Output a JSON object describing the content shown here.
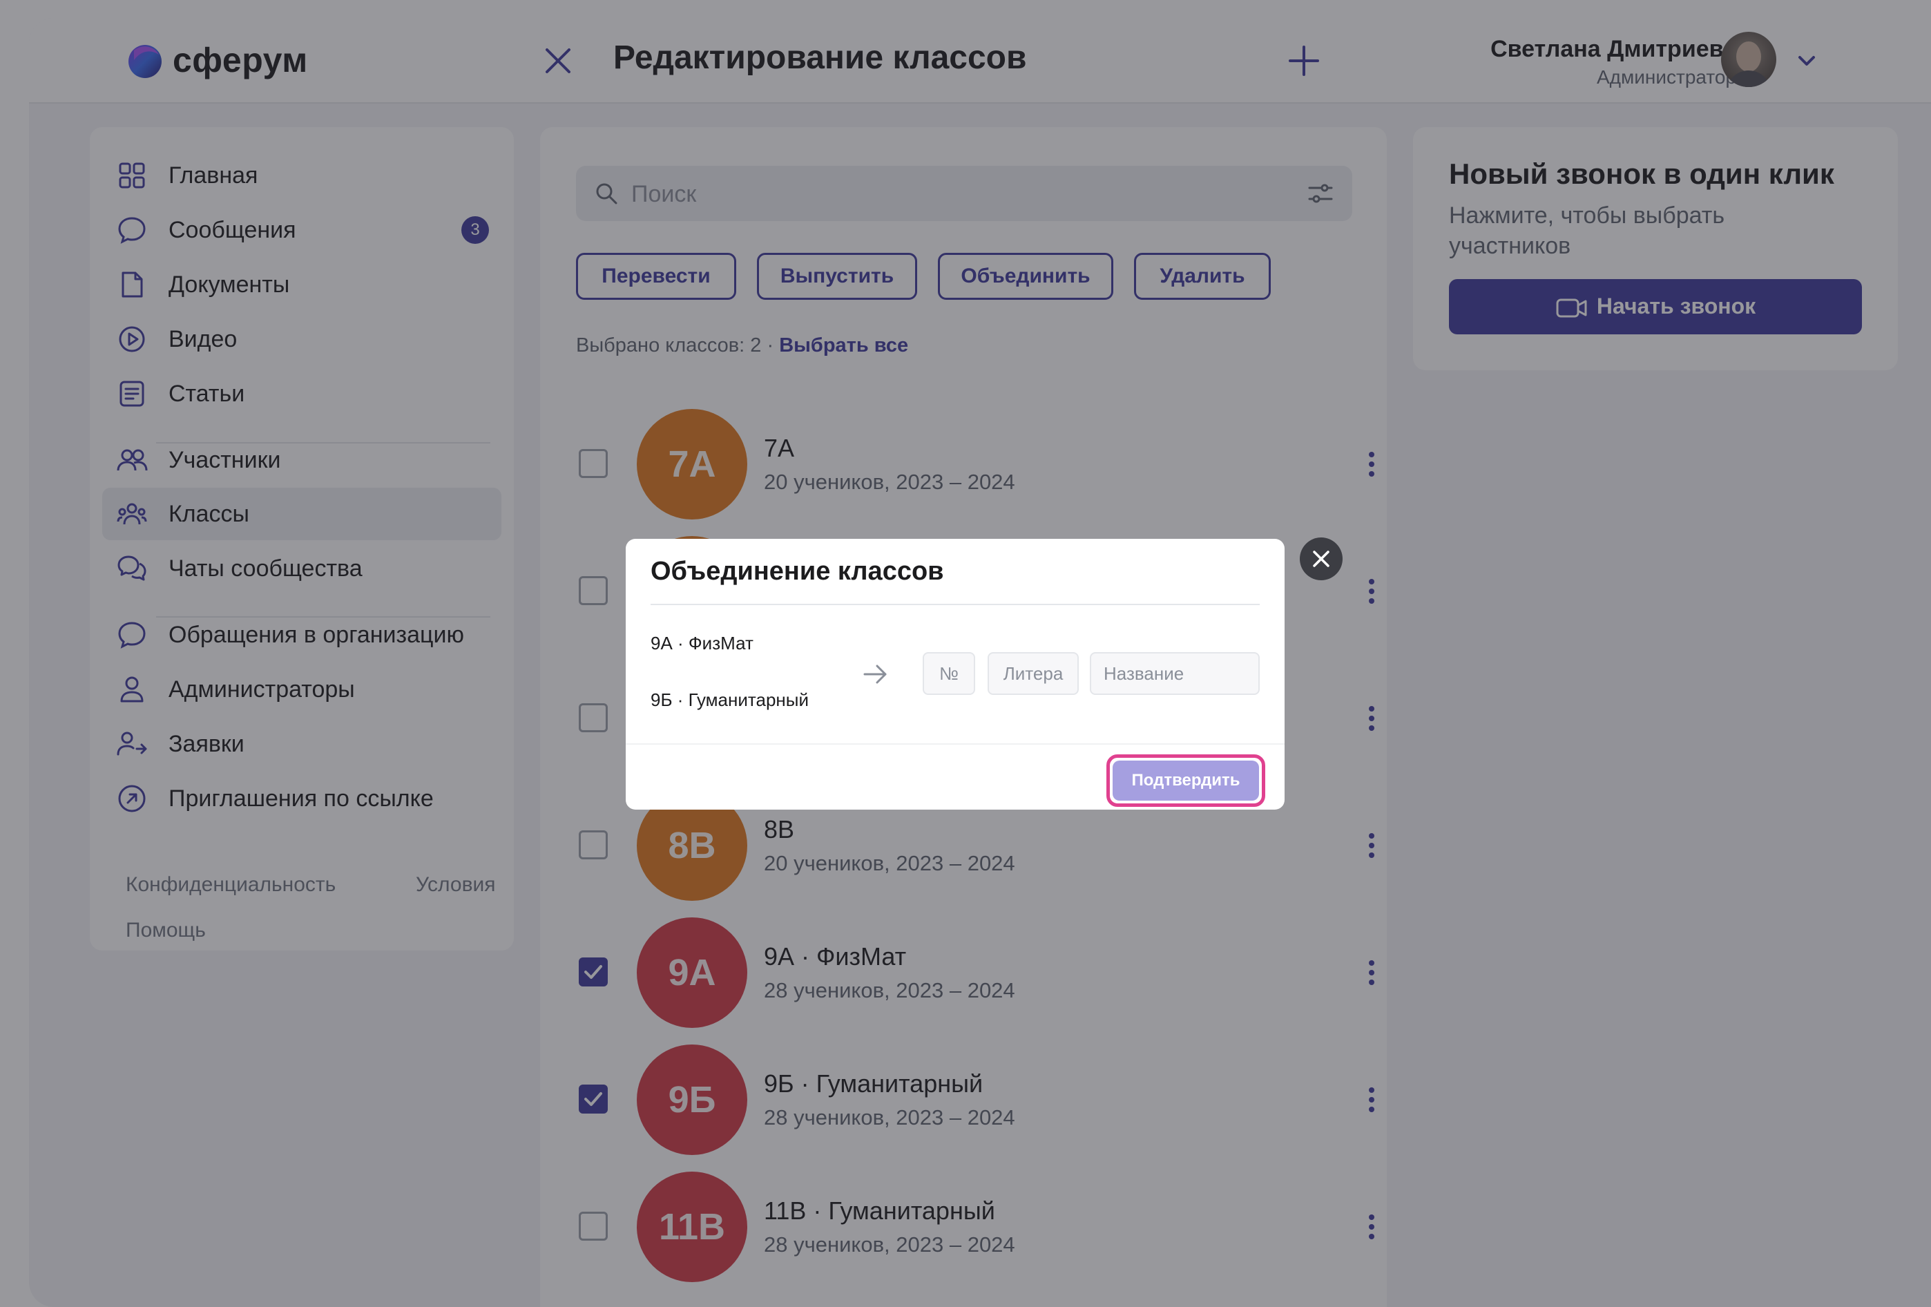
{
  "header": {
    "logo_text": "сферум",
    "title": "Редактирование классов",
    "user_name": "Светлана Дмитриева",
    "user_role": "Администратор"
  },
  "sidebar": {
    "items": [
      {
        "label": "Главная",
        "icon": "home-grid-icon"
      },
      {
        "label": "Сообщения",
        "icon": "chat-bubble-icon",
        "badge": "3"
      },
      {
        "label": "Документы",
        "icon": "document-icon"
      },
      {
        "label": "Видео",
        "icon": "video-play-icon"
      },
      {
        "label": "Статьи",
        "icon": "article-icon"
      },
      {
        "label": "Участники",
        "icon": "people-icon"
      },
      {
        "label": "Классы",
        "icon": "class-group-icon",
        "active": true
      },
      {
        "label": "Чаты сообщества",
        "icon": "community-chats-icon"
      },
      {
        "label": "Обращения в организацию",
        "icon": "chat-bubble-icon"
      },
      {
        "label": "Администраторы",
        "icon": "person-icon"
      },
      {
        "label": "Заявки",
        "icon": "request-icon"
      },
      {
        "label": "Приглашения по ссылке",
        "icon": "link-invite-icon"
      }
    ],
    "footer": {
      "privacy": "Конфиденциальность",
      "terms": "Условия",
      "help": "Помощь"
    }
  },
  "main": {
    "search_placeholder": "Поиск",
    "actions": [
      "Перевести",
      "Выпустить",
      "Объединить",
      "Удалить"
    ],
    "selection_text": "Выбрано классов: 2 ·",
    "select_all": "Выбрать все",
    "classes": [
      {
        "avatar": "7А",
        "name": "7А",
        "meta": "20 учеников, 2023 – 2024",
        "checked": false,
        "color": "#e07a1f"
      },
      {
        "avatar": "",
        "name": "",
        "meta": "",
        "checked": false,
        "color": "#e07a1f"
      },
      {
        "avatar": "",
        "name": "",
        "meta": "",
        "checked": false,
        "color": "#e07a1f"
      },
      {
        "avatar": "8В",
        "name": "8В",
        "meta": "20 учеников, 2023 – 2024",
        "checked": false,
        "color": "#e07a1f"
      },
      {
        "avatar": "9А",
        "name": "9А · ФизМат",
        "meta": "28 учеников, 2023 – 2024",
        "checked": true,
        "color": "#d23a46"
      },
      {
        "avatar": "9Б",
        "name": "9Б · Гуманитарный",
        "meta": "28 учеников, 2023 – 2024",
        "checked": true,
        "color": "#d23a46"
      },
      {
        "avatar": "11В",
        "name": "11В · Гуманитарный",
        "meta": "28 учеников, 2023 – 2024",
        "checked": false,
        "color": "#d23a46"
      }
    ]
  },
  "call_card": {
    "title": "Новый звонок в один клик",
    "subtitle": "Нажмите, чтобы выбрать участников",
    "button": "Начать звонок"
  },
  "modal": {
    "title": "Объединение классов",
    "sources": [
      "9А · ФизМат",
      "9Б · Гуманитарный"
    ],
    "number_placeholder": "№",
    "letter_placeholder": "Литера",
    "name_placeholder": "Название",
    "confirm": "Подтвердить"
  },
  "colors": {
    "accent": "#3f3a9b",
    "highlight": "#e0418f",
    "confirm_disabled": "#a59fe0"
  }
}
